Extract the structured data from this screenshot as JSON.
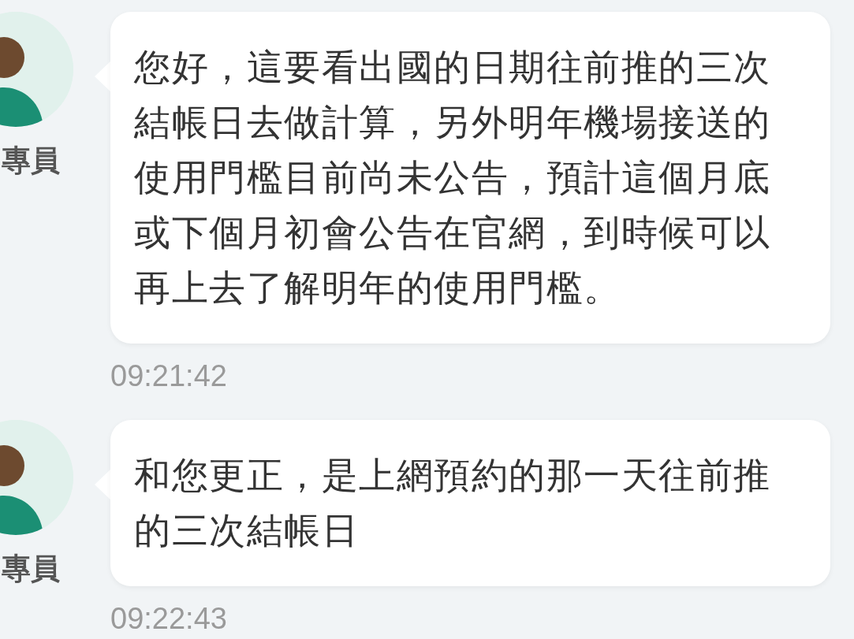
{
  "messages": [
    {
      "sender": "專員",
      "text": "您好，這要看出國的日期往前推的三次結帳日去做計算，另外明年機場接送的使用門檻目前尚未公告，預計這個月底或下個月初會公告在官網，到時候可以再上去了解明年的使用門檻。",
      "time": "09:21:42"
    },
    {
      "sender": "專員",
      "text": "和您更正，是上網預約的那一天往前推的三次結帳日",
      "time": "09:22:43"
    }
  ]
}
